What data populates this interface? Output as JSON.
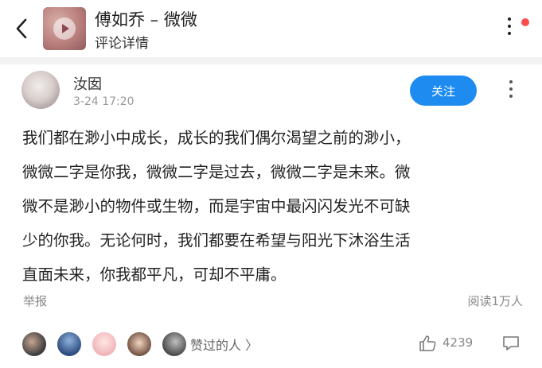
{
  "header": {
    "title": "傅如乔 – 微微",
    "subtitle": "评论详情"
  },
  "post": {
    "author": "汝囡",
    "time": "3-24 17:20",
    "follow_label": "关注",
    "lines": [
      "我们都在渺小中成长，成长的我们偶尔渴望之前的渺小，",
      "微微二字是你我，微微二字是过去，微微二字是未来。微",
      "微不是渺小的物件或生物，而是宇宙中最闪闪发光不可缺",
      "少的你我。无论何时，我们都要在希望与阳光下沐浴生活",
      "直面未来，你我都平凡，可却不平庸。"
    ],
    "report_label": "举报",
    "read_count": "阅读1万人"
  },
  "footer": {
    "liked_by_label": "赞过的人 〉",
    "like_count": "4239"
  },
  "colors": {
    "accent": "#1e8bf1",
    "notification_dot": "#ff4d4f",
    "separator": "#f2f2f2"
  },
  "icons": {
    "back": "chevron-left-icon",
    "more": "more-vertical-icon",
    "play": "play-icon",
    "like": "thumbs-up-icon",
    "reply": "comment-icon"
  }
}
